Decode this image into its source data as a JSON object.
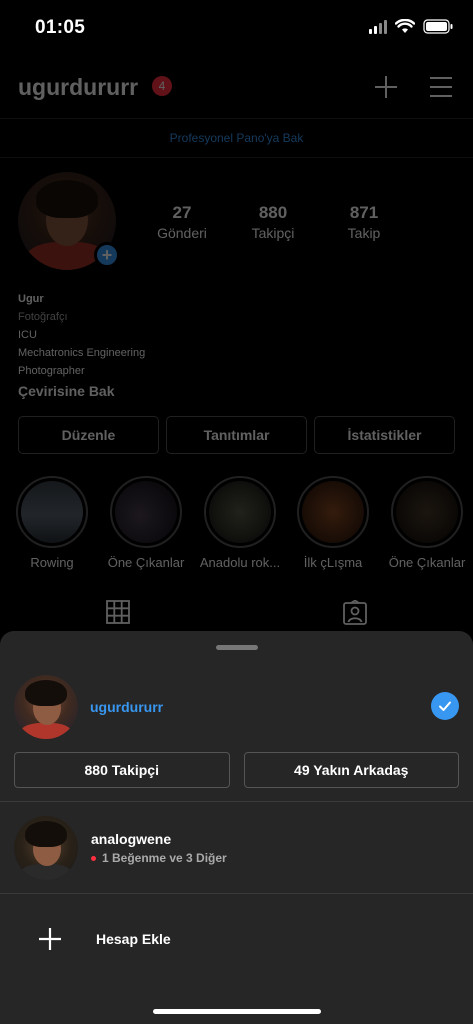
{
  "status_bar": {
    "time": "01:05"
  },
  "profile": {
    "username": "ugurdururr",
    "notification_count": "4",
    "professional_dashboard": "Profesyonel Pano'ya Bak",
    "stats": [
      {
        "value": "27",
        "label": "Gönderi"
      },
      {
        "value": "880",
        "label": "Takipçi"
      },
      {
        "value": "871",
        "label": "Takip"
      }
    ],
    "bio": {
      "name": "Ugur",
      "category": "Fotoğrafçı",
      "lines": [
        "ICU",
        "Mechatronics Engineering",
        "Photographer"
      ],
      "translate": "Çevirisine Bak"
    },
    "action_buttons": [
      "Düzenle",
      "Tanıtımlar",
      "İstatistikler"
    ],
    "highlights": [
      {
        "label": "Rowing",
        "color": "#4a5560"
      },
      {
        "label": "Öne Çıkanlar",
        "color": "#2a2530"
      },
      {
        "label": "Anadolu rok...",
        "color": "#3a3a30"
      },
      {
        "label": "İlk çLışma",
        "color": "#6a3a20"
      },
      {
        "label": "Öne Çıkanlar",
        "color": "#2a2018"
      }
    ],
    "tab_icons": [
      "grid-icon",
      "tagged-icon"
    ]
  },
  "account_sheet": {
    "current_account": {
      "username": "ugurdururr",
      "selected": true
    },
    "buttons": [
      "880 Takipçi",
      "49 Yakın Arkadaş"
    ],
    "other_account": {
      "username": "analogwene",
      "activity": "1 Beğenme ve 3 Diğer"
    },
    "add_account": "Hesap Ekle"
  },
  "colors": {
    "accent": "#3897f0",
    "badge": "#ff3040",
    "sheet_background": "#262626"
  }
}
